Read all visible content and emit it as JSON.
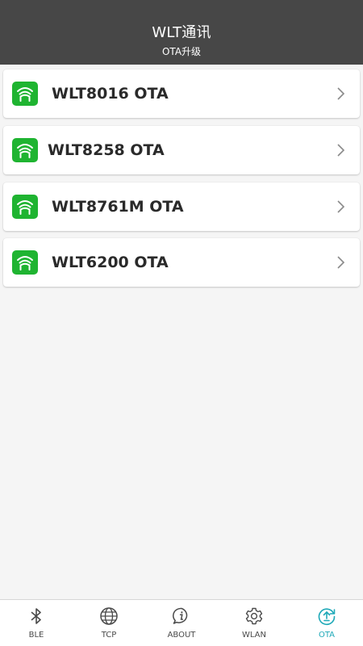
{
  "header": {
    "title": "WLT通讯",
    "subtitle": "OTA升级"
  },
  "list": {
    "items": [
      {
        "label": "WLT8016 OTA"
      },
      {
        "label": "WLT8258 OTA"
      },
      {
        "label": "WLT8761M OTA"
      },
      {
        "label": "WLT6200 OTA"
      }
    ]
  },
  "tabbar": {
    "active_tab": "OTA",
    "active_color": "#1fa9b8",
    "tabs": [
      {
        "label": "BLE",
        "icon": "bluetooth-icon"
      },
      {
        "label": "TCP",
        "icon": "globe-icon"
      },
      {
        "label": "ABOUT",
        "icon": "info-bubble-icon"
      },
      {
        "label": "WLAN",
        "icon": "gear-icon"
      },
      {
        "label": "OTA",
        "icon": "ota-update-icon"
      }
    ]
  },
  "colors": {
    "header_bg": "#474747",
    "icon_green": "#1fb431",
    "page_bg": "#f5f5f5"
  }
}
